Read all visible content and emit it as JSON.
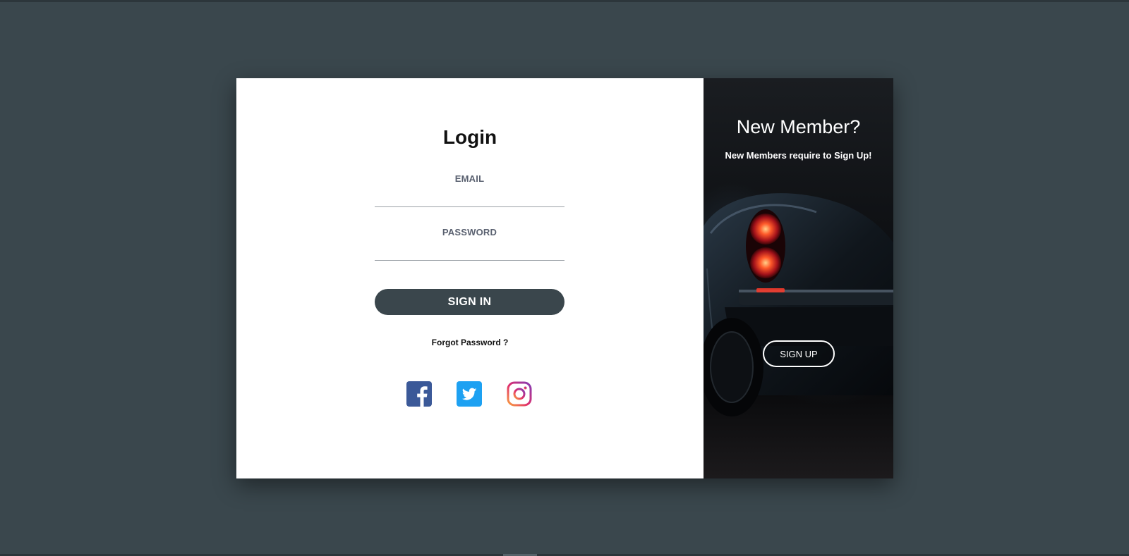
{
  "login": {
    "title": "Login",
    "email_label": "EMAIL",
    "email_value": "",
    "password_label": "PASSWORD",
    "password_value": "",
    "signin_label": "SIGN IN",
    "forgot_label": "Forgot Password ?",
    "social": [
      {
        "icon": "facebook-icon",
        "color": "#3b5998"
      },
      {
        "icon": "twitter-icon",
        "color": "#1da1f2"
      },
      {
        "icon": "instagram-icon",
        "color": "#c13584"
      }
    ]
  },
  "signup": {
    "title": "New Member?",
    "subtitle": "New Members require to Sign Up!",
    "button_label": "SIGN UP"
  },
  "colors": {
    "page_background": "#3a474d",
    "signin_button": "#3a464c",
    "card_background": "#ffffff"
  }
}
